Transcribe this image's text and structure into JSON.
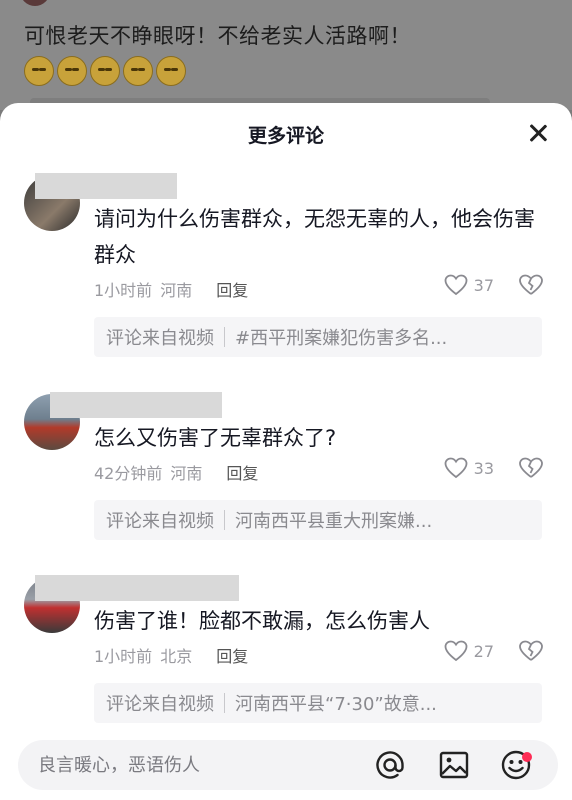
{
  "background": {
    "text": "可恨老天不睁眼呀！不给老实人活路啊！"
  },
  "sheet": {
    "title": "更多评论"
  },
  "comments": [
    {
      "text": "请问为什么伤害群众，无怨无辜的人，他会伤害群众",
      "time": "1小时前",
      "location": "河南",
      "reply": "回复",
      "likes": "37",
      "source_label": "评论来自视频",
      "source_title": "#西平刑案嫌犯伤害多名..."
    },
    {
      "text": "怎么又伤害了无辜群众了?",
      "time": "42分钟前",
      "location": "河南",
      "reply": "回复",
      "likes": "33",
      "source_label": "评论来自视频",
      "source_title": "河南西平县重大刑案嫌..."
    },
    {
      "text": "伤害了谁！脸都不敢漏，怎么伤害人",
      "time": "1小时前",
      "location": "北京",
      "reply": "回复",
      "likes": "27",
      "source_label": "评论来自视频",
      "source_title": "河南西平县“7·30”故意..."
    }
  ],
  "input": {
    "placeholder": "良言暖心，恶语伤人"
  },
  "icons": {
    "close": "close-icon",
    "like": "heart-icon",
    "dislike": "broken-heart-icon",
    "mention": "at-icon",
    "image": "image-icon",
    "emoji": "emoji-icon"
  },
  "colors": {
    "accent_dot": "#fe2c55"
  }
}
